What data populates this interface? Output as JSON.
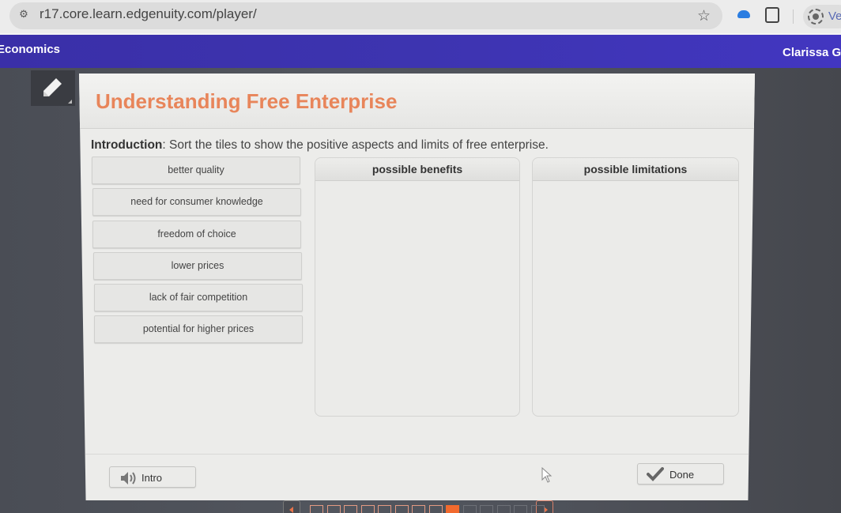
{
  "browser": {
    "url": "r17.core.learn.edgenuity.com/player/",
    "profile_label": "Ver"
  },
  "header": {
    "course_title": "Economics",
    "user_name": "Clarissa Go"
  },
  "activity": {
    "title": "Understanding Free Enterprise",
    "intro_label": "Introduction",
    "intro_text": ": Sort the tiles to show the positive aspects and limits of free enterprise.",
    "tiles": [
      "better quality",
      "need for consumer knowledge",
      "freedom of choice",
      "lower prices",
      "lack of fair competition",
      "potential for higher prices"
    ],
    "zones": [
      {
        "label": "possible benefits",
        "items": []
      },
      {
        "label": "possible limitations",
        "items": []
      }
    ]
  },
  "footer": {
    "intro_button": "Intro",
    "done_button": "Done"
  },
  "pager": {
    "total": 14,
    "current": 9,
    "completed": 8
  },
  "colors": {
    "header_bg": "#3d34b0",
    "title": "#e8855a",
    "pager_current": "#f26a2e"
  }
}
